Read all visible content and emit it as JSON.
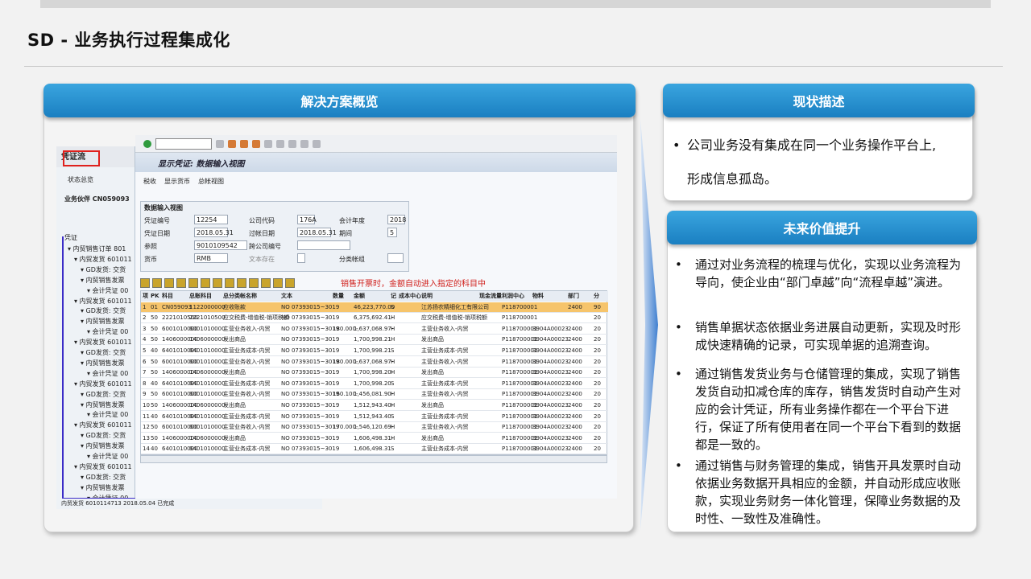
{
  "slide": {
    "title": "SD - 业务执行过程集成化"
  },
  "panels": {
    "solution_title": "解决方案概览",
    "status_title": "现状描述",
    "future_title": "未来价值提升"
  },
  "status": {
    "text_line1": "公司业务没有集成在同一个业务操作平台上,",
    "text_line2": "形成信息孤岛。"
  },
  "future": {
    "items": [
      "通过对业务流程的梳理与优化，实现以业务流程为导向，使企业由“部门卓越”向“流程卓越”演进。",
      "销售单据状态依据业务进展自动更新，实现及时形成快速精确的记录，可实现单据的追溯查询。",
      "通过销售发货业务与仓储管理的集成，实现了销售发货自动扣减仓库的库存，销售发货时自动产生对应的会计凭证，所有业务操作都在一个平台下进行，保证了所有使用者在同一个平台下看到的数据都是一致的。",
      "通过销售与财务管理的集成，销售开具发票时自动依据业务数据开具相应的金额，并自动形成应收账款，实现业务财务一体化管理，保障业务数据的及时性、一致性及准确性。"
    ]
  },
  "sap": {
    "tree_header": "凭证流",
    "tree_tools": "状态总览",
    "partner": "业务伙伴 CN059093",
    "tree_label": "凭证",
    "tree_lines": [
      "内贸销售订单 801",
      "内贸发货 601011",
      "GD发货: 交货",
      "内贸销售发票",
      "会计凭证 00",
      "内贸发货 601011",
      "GD发货: 交货",
      "内贸销售发票",
      "会计凭证 00",
      "内贸发货 601011",
      "GD发货: 交货",
      "内贸销售发票",
      "会计凭证 00",
      "内贸发货 601011",
      "GD发货: 交货",
      "内贸销售发票",
      "会计凭证 00",
      "内贸发货 601011",
      "GD发货: 交货",
      "内贸销售发票",
      "会计凭证 00",
      "内贸发货 601011",
      "GD发货: 交货",
      "内贸销售发票",
      "会计凭证 00"
    ],
    "bottom_row": "内贸发货 6010114713      2018.05.04 已完成",
    "window_title": "显示凭证: 数据输入视图",
    "tools": [
      "税收",
      "显示货币",
      "总帐视图"
    ],
    "form_title": "数据输入视图",
    "form": {
      "doc_no_label": "凭证编号",
      "doc_no": "12254",
      "company_label": "公司代码",
      "company": "176A",
      "fy_label": "会计年度",
      "fy": "2018",
      "doc_date_label": "凭证日期",
      "doc_date": "2018.05.31",
      "post_date_label": "过帐日期",
      "post_date": "2018.05.31",
      "period_label": "期间",
      "period": "5",
      "ref_label": "参照",
      "ref": "9010109542",
      "cc_label": "跨公司编号",
      "cc": "",
      "cur_label": "货币",
      "cur": "RMB",
      "text_label": "文本存在",
      "ledger_label": "分类帐组"
    },
    "note": "销售开票时，金额自动进入指定的科目中",
    "grid_header": [
      "项",
      "PK",
      "科目",
      "总账科目",
      "总分类帐名称",
      "文本",
      "数量",
      "金额",
      "记",
      "成本中心",
      "说明",
      "现金流量",
      "利润中心",
      "物料",
      "部门",
      "分"
    ],
    "grid_rows": [
      [
        "1",
        "01",
        "CN059093",
        "1122000000",
        "应收账款",
        "NO 07393015~3019",
        "",
        "46,223,770.00",
        "S",
        "",
        "江苏扬农精细化工有限公司",
        "",
        "P118700001",
        "",
        "2400",
        "90"
      ],
      [
        "2",
        "50",
        "2221010500",
        "2221010500",
        "应交税费-增值税-销项税额",
        "NO 07393015~3019",
        "",
        "6,375,692.41-",
        "H",
        "",
        "应交税费-增值税-销项税额",
        "",
        "P118700001",
        "",
        "",
        "20"
      ],
      [
        "3",
        "50",
        "6001010000",
        "6001010000",
        "主营业务收入-内贸",
        "NO 07393015~3019",
        "180.000-",
        "1,637,068.97-",
        "H",
        "",
        "主营业务收入-内贸",
        "",
        "P118700001",
        "3904A00023",
        "2400",
        "20"
      ],
      [
        "4",
        "50",
        "1406000000",
        "1406000000",
        "发出商品",
        "NO 07393015~3019",
        "",
        "1,700,998.21",
        "H",
        "",
        "发出商品",
        "",
        "P118700001",
        "3904A00023",
        "2400",
        "20"
      ],
      [
        "5",
        "40",
        "6401010000",
        "6401010000",
        "主营业务成本-内贸",
        "NO 07393015~3019",
        "",
        "1,700,998.21",
        "S",
        "",
        "主营业务成本-内贸",
        "",
        "P118700001",
        "3904A00023",
        "2400",
        "20"
      ],
      [
        "6",
        "50",
        "6001010000",
        "6001010000",
        "主营业务收入-内贸",
        "NO 07393015~3019",
        "180.000-",
        "1,637,068.97-",
        "H",
        "",
        "主营业务收入-内贸",
        "",
        "P118700001",
        "3904A00023",
        "2400",
        "20"
      ],
      [
        "7",
        "50",
        "1406000000",
        "1406000000",
        "发出商品",
        "NO 07393015~3019",
        "",
        "1,700,998.20-",
        "H",
        "",
        "发出商品",
        "",
        "P118700001",
        "3904A00023",
        "2400",
        "20"
      ],
      [
        "8",
        "40",
        "6401010000",
        "6401010000",
        "主营业务成本-内贸",
        "NO 07393015~3019",
        "",
        "1,700,998.20",
        "S",
        "",
        "主营业务成本-内贸",
        "",
        "P118700001",
        "3904A00023",
        "2400",
        "20"
      ],
      [
        "9",
        "50",
        "6001010000",
        "6001010000",
        "主营业务收入-内贸",
        "NO 07393015~3019",
        "160.100-",
        "1,456,081.90-",
        "H",
        "",
        "主营业务收入-内贸",
        "",
        "P118700001",
        "3904A00023",
        "2400",
        "20"
      ],
      [
        "10",
        "50",
        "1406000000",
        "1406000000",
        "发出商品",
        "NO 07393015~3019",
        "",
        "1,512,943.40-",
        "H",
        "",
        "发出商品",
        "",
        "P118700001",
        "3904A00023",
        "2400",
        "20"
      ],
      [
        "11",
        "40",
        "6401010000",
        "6401010000",
        "主营业务成本-内贸",
        "NO 07393015~3019",
        "",
        "1,512,943.40",
        "S",
        "",
        "主营业务成本-内贸",
        "",
        "P118700001",
        "3904A00023",
        "2400",
        "20"
      ],
      [
        "12",
        "50",
        "6001010000",
        "6001010000",
        "主营业务收入-内贸",
        "NO 07393015~3019",
        "170.000-",
        "1,546,120.69-",
        "H",
        "",
        "主营业务收入-内贸",
        "",
        "P118700001",
        "3904A00023",
        "2400",
        "20"
      ],
      [
        "13",
        "50",
        "1406000000",
        "1406000000",
        "发出商品",
        "NO 07393015~3019",
        "",
        "1,606,498.31-",
        "H",
        "",
        "发出商品",
        "",
        "P118700001",
        "3904A00023",
        "2400",
        "20"
      ],
      [
        "14",
        "40",
        "6401010000",
        "6401010000",
        "主营业务成本-内贸",
        "NO 07393015~3019",
        "",
        "1,606,498.31",
        "S",
        "",
        "主营业务成本-内贸",
        "",
        "P118700001",
        "3904A00023",
        "2400",
        "20"
      ]
    ]
  }
}
